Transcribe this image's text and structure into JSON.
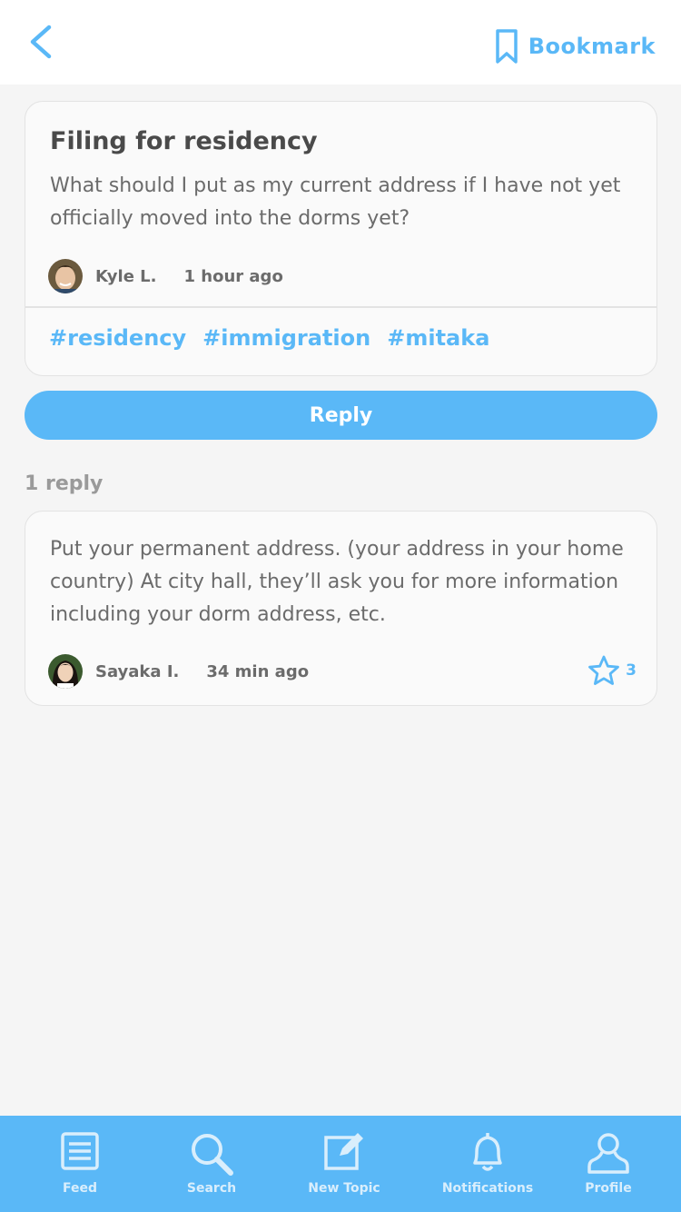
{
  "header": {
    "bookmark_label": "Bookmark"
  },
  "post": {
    "title": "Filing for residency",
    "body": "What should I put as my current address if I have not yet officially moved into the dorms yet?",
    "author": "Kyle L.",
    "time": "1 hour ago",
    "tags": [
      "#residency",
      "#immigration",
      "#mitaka"
    ]
  },
  "reply_button_label": "Reply",
  "reply_count_label": "1 reply",
  "replies": [
    {
      "body": "Put your permanent address. (your address in your home country) At city hall, they’ll ask you for more information including your dorm address, etc.",
      "author": "Sayaka I.",
      "time": "34 min ago",
      "stars": "3"
    }
  ],
  "tabbar": {
    "items": [
      {
        "label": "Feed",
        "icon": "feed-icon"
      },
      {
        "label": "Search",
        "icon": "search-icon"
      },
      {
        "label": "New Topic",
        "icon": "compose-icon"
      },
      {
        "label": "Notifications",
        "icon": "bell-icon"
      },
      {
        "label": "Profile",
        "icon": "profile-icon"
      }
    ]
  },
  "colors": {
    "accent": "#5ab8f7",
    "background": "#f5f5f5",
    "text": "#6b6b6b"
  }
}
